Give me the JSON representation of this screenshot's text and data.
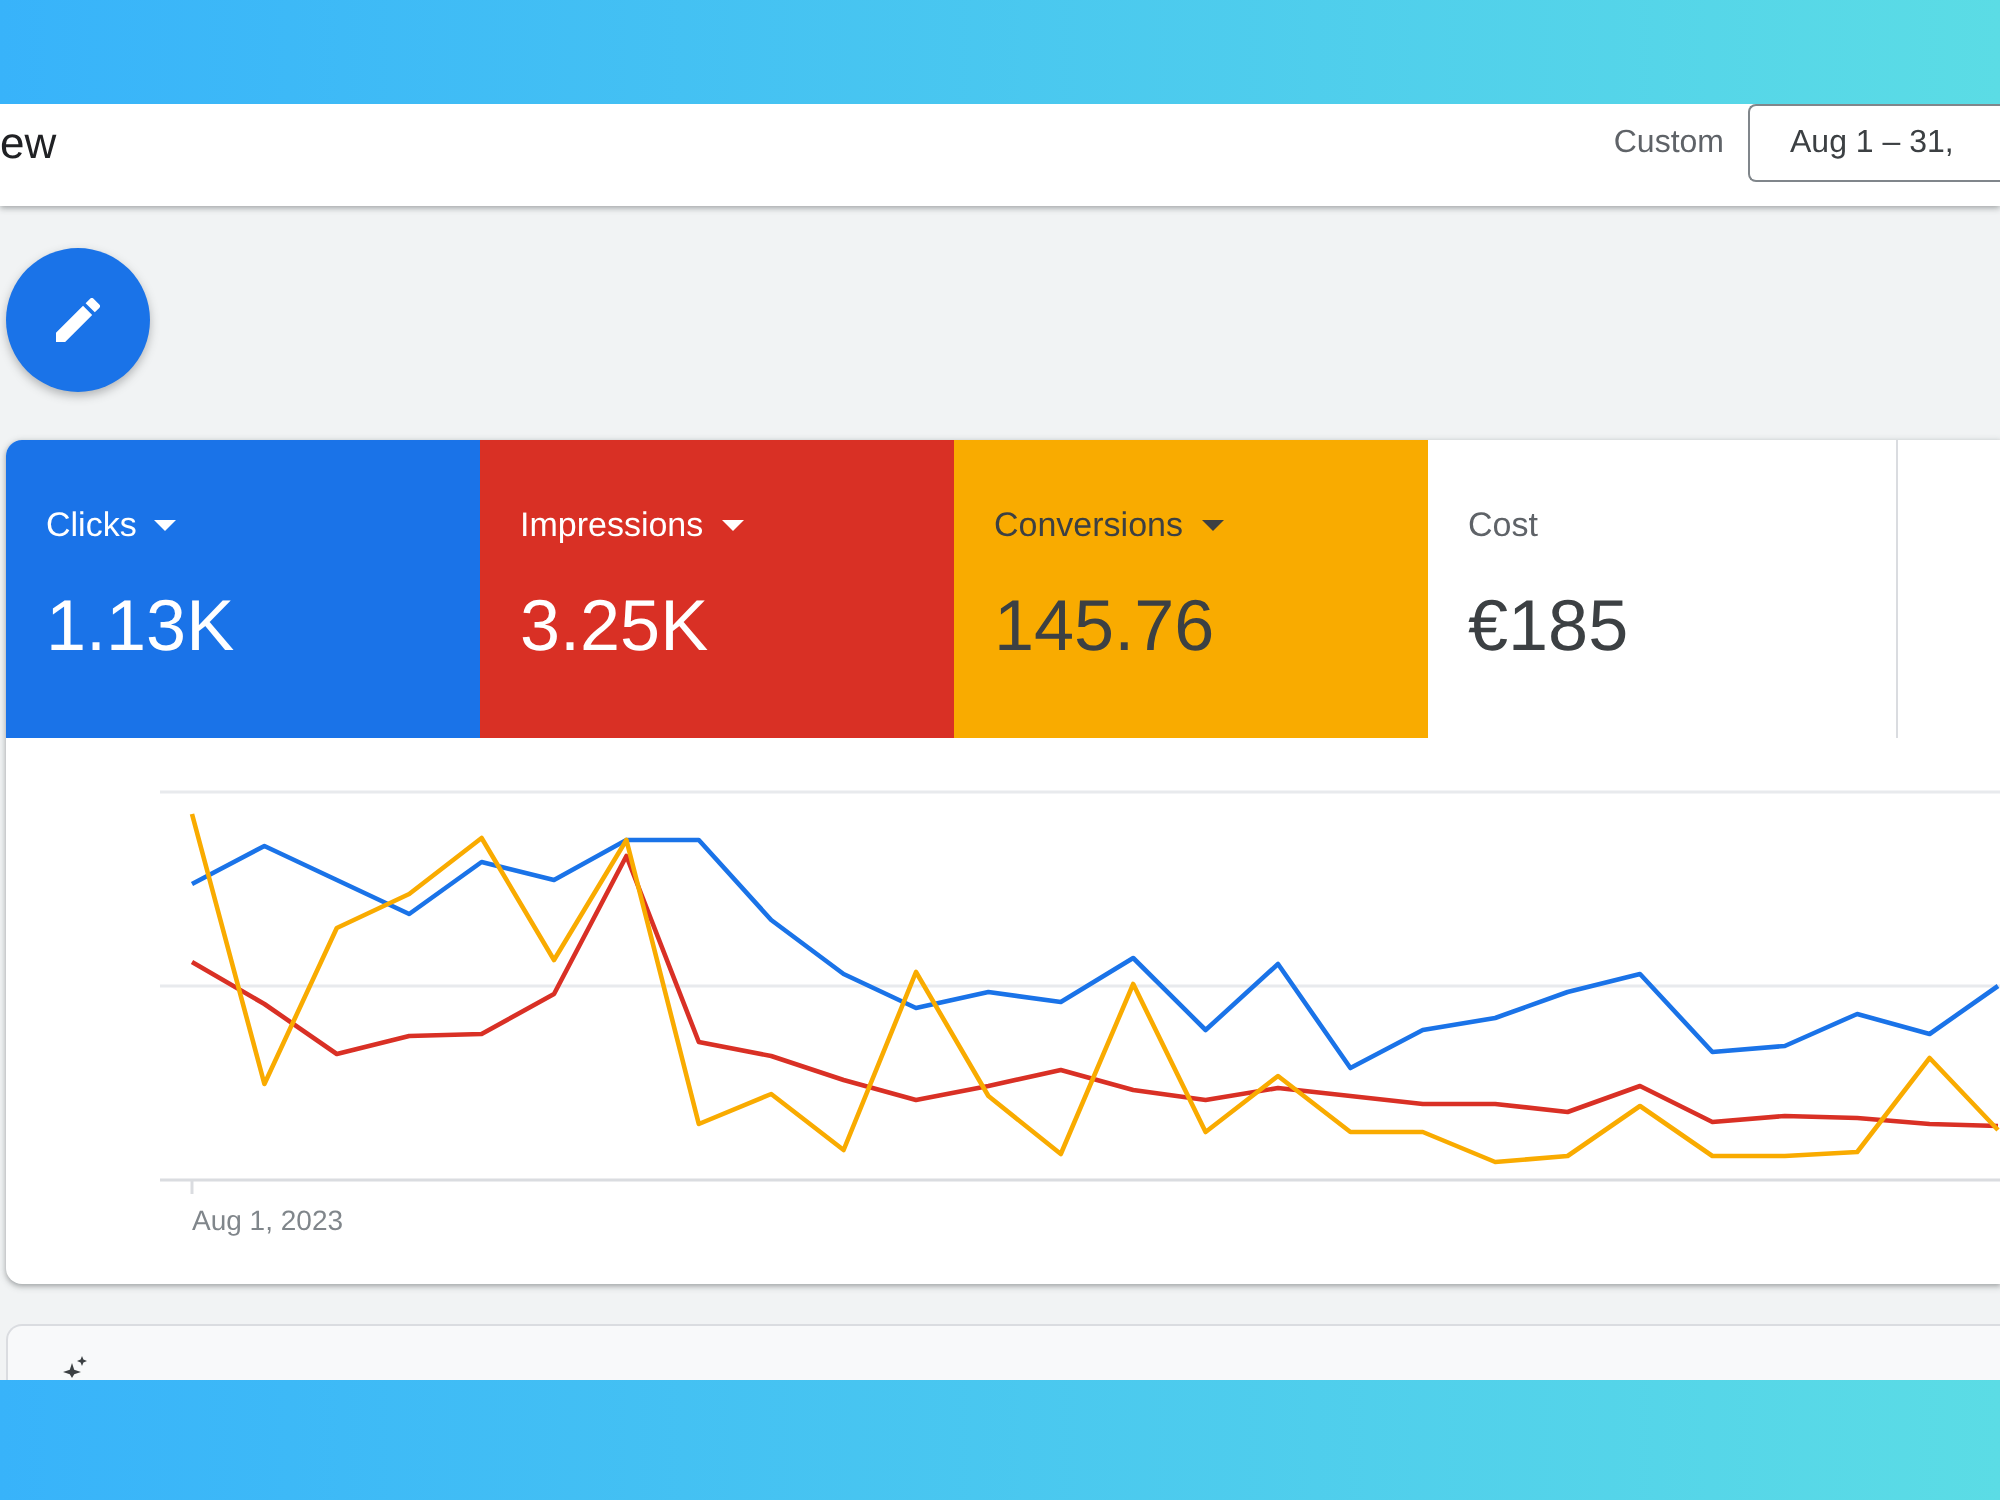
{
  "header": {
    "title": "ew",
    "date_range_label": "Custom",
    "date_range": "Aug 1 – 31,"
  },
  "metrics": [
    {
      "label": "Clicks",
      "value": "1.13K",
      "selected": true,
      "color": "#1a73e8"
    },
    {
      "label": "Impressions",
      "value": "3.25K",
      "selected": true,
      "color": "#d93025"
    },
    {
      "label": "Conversions",
      "value": "145.76",
      "selected": true,
      "color": "#f9ab00"
    },
    {
      "label": "Cost",
      "value": "€185",
      "selected": false
    }
  ],
  "chart": {
    "x_label": "Aug 1, 2023"
  }
}
